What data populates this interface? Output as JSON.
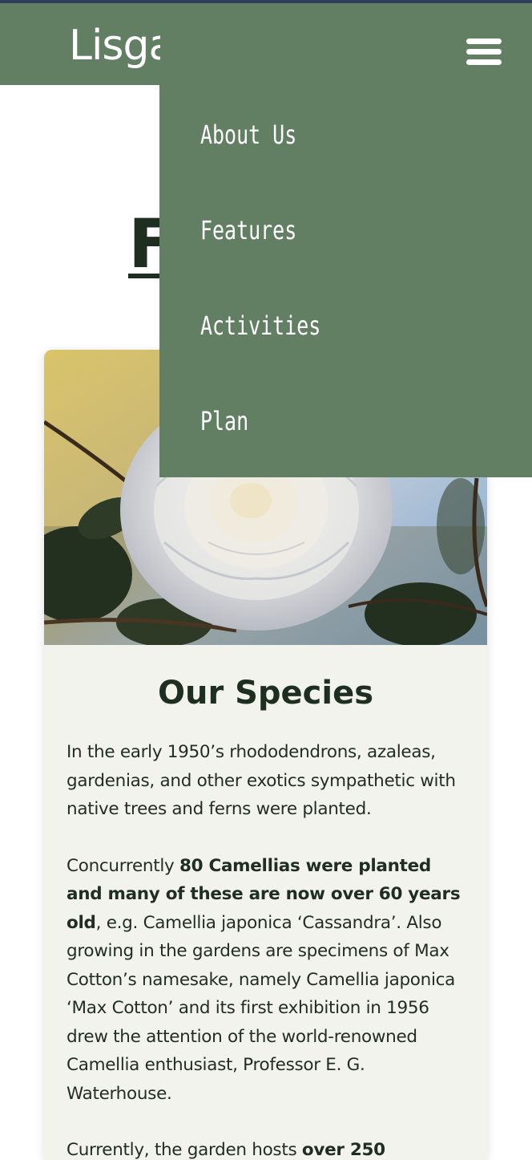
{
  "header": {
    "logo_text": "Lisgar Gardens",
    "menu_icon": "hamburger-menu-icon",
    "background_color": "#627f64"
  },
  "page": {
    "title": "Features"
  },
  "nav_menu": {
    "items": [
      {
        "label": "About Us"
      },
      {
        "label": "Features"
      },
      {
        "label": "Activities"
      },
      {
        "label": "Plan"
      }
    ]
  },
  "card": {
    "image_alt": "White camellia flower",
    "heading": "Our Species",
    "paragraph1": "In the early 1950’s rhododendrons, azaleas, gardenias, and other exotics sympathetic with native trees and ferns were planted.",
    "paragraph2": {
      "intro": "Concurrently ",
      "bold": "80 Camellias were planted and many of these are now over 60 years old",
      "rest": ", e.g. Camellia japonica ‘Cassandra’. Also growing in the gardens are specimens of Max Cotton’s namesake, namely Camellia japonica ‘Max Cotton’ and its first exhibition in 1956 drew the attention of the world-renowned Camellia enthusiast, Professor E. G. Waterhouse."
    },
    "paragraph3": {
      "intro": "Currently, the garden hosts ",
      "bold": "over 250"
    }
  },
  "colors": {
    "accent": "#627f64",
    "heading": "#1e2f22",
    "card_background": "#f2f3ec"
  }
}
